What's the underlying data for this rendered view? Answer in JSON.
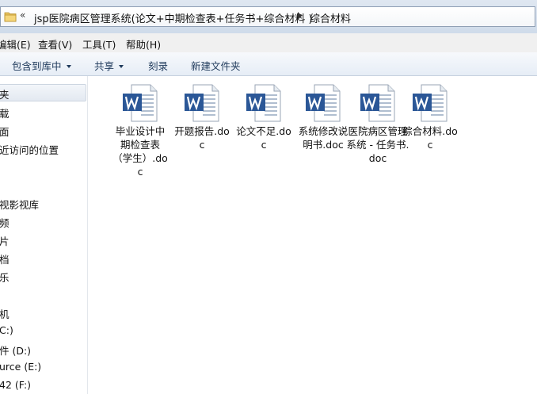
{
  "address_bar": {
    "chevron": "«",
    "path": "jsp医院病区管理系统(论文+中期检查表+任务书+综合材料 )",
    "current": "综合材料"
  },
  "menu": {
    "items": [
      "编辑(E)",
      "查看(V)",
      "工具(T)",
      "帮助(H)"
    ]
  },
  "toolbar": {
    "include_label": "包含到库中",
    "share_label": "共享",
    "burn_label": "刻录",
    "new_folder_label": "新建文件夹"
  },
  "nav": {
    "items": [
      "夹",
      "载",
      "面",
      "近访问的位置",
      "视影视库",
      "频",
      "片",
      "档",
      "乐",
      "机",
      "C:)",
      "件 (D:)",
      "urce (E:)",
      "42 (F:)"
    ]
  },
  "files": [
    {
      "name": "毕业设计中期检查表（学生）.doc",
      "icon": "word-doc-icon"
    },
    {
      "name": "开题报告.doc",
      "icon": "word-doc-icon"
    },
    {
      "name": "论文不足.doc",
      "icon": "word-doc-icon"
    },
    {
      "name": "系统修改说明书.doc",
      "icon": "word-doc-icon"
    },
    {
      "name": "医院病区管理系统 - 任务书.doc",
      "icon": "word-doc-icon"
    },
    {
      "name": "综合材料.doc",
      "icon": "word-doc-icon"
    }
  ],
  "colors": {
    "word_blue": "#2b5797",
    "toolbar_text": "#1e395b"
  }
}
